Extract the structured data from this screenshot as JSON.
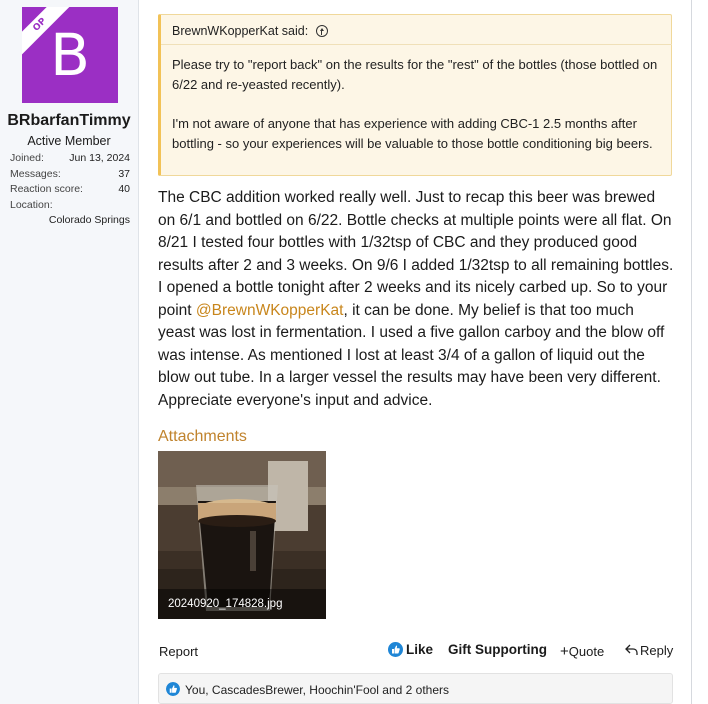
{
  "user": {
    "avatar_letter": "B",
    "op_badge": "OP",
    "avatar_color": "#9b2fc4",
    "username": "BRbarfanTimmy",
    "title": "Active Member",
    "stats": [
      {
        "label": "Joined:",
        "value": "Jun 13, 2024"
      },
      {
        "label": "Messages:",
        "value": "37"
      },
      {
        "label": "Reaction score:",
        "value": "40"
      },
      {
        "label": "Location:",
        "value": "Colorado Springs"
      }
    ]
  },
  "quote": {
    "author_line": "BrewnWKopperKat said:",
    "paragraphs": [
      "Please try to \"report back\" on the results for the \"rest\" of the bottles (those bottled on 6/22 and re-yeasted recently).",
      "I'm not aware of anyone that has experience with adding CBC-1 2.5 months after bottling - so your experiences will be valuable to those bottle conditioning big beers."
    ]
  },
  "message": {
    "before_mention": "The CBC addition worked really well. Just to recap this beer was brewed on 6/1 and bottled on 6/22. Bottle checks at multiple points were all flat. On 8/21 I tested four bottles with 1/32tsp of CBC and they produced good results after 2 and 3 weeks. On 9/6 I added 1/32tsp to all remaining bottles. I opened a bottle tonight after 2 weeks and its nicely carbed up. So to your point ",
    "mention": "@BrewnWKopperKat",
    "after_mention": ", it can be done. My belief is that too much yeast was lost in fermentation. I used a five gallon carboy and the blow off was intense. As mentioned I lost at least 3/4 of a gallon of liquid out the blow out tube. In a larger vessel the results may have been very different. Appreciate everyone's input and advice."
  },
  "attachments": {
    "title": "Attachments",
    "items": [
      {
        "filename": "20240920_174828.jpg"
      }
    ]
  },
  "actions": {
    "report": "Report",
    "like": "Like",
    "gift": "Gift Supporting",
    "quote": "Quote",
    "reply": "Reply"
  },
  "reactions": {
    "text": "You, CascadesBrewer, Hoochin'Fool and 2 others"
  },
  "colors": {
    "accent": "#c0832d",
    "mention": "#c8861c",
    "like_blue": "#1f86d6",
    "quote_bg": "#fdf6e6"
  }
}
